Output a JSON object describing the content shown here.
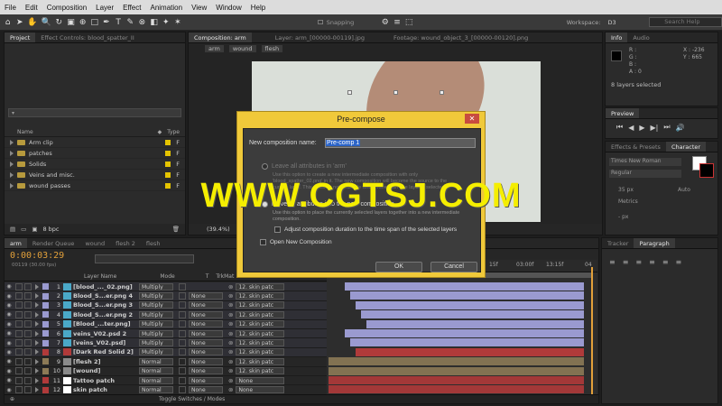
{
  "menu": [
    "File",
    "Edit",
    "Composition",
    "Layer",
    "Effect",
    "Animation",
    "View",
    "Window",
    "Help"
  ],
  "toolbar": {
    "snapping": "Snapping",
    "workspace_label": "Workspace:",
    "workspace_value": "D3",
    "search_placeholder": "Search Help"
  },
  "project_panel": {
    "tabs": [
      "Project",
      "Effect Controls: blood_spatter_II"
    ],
    "columns": {
      "name": "Name",
      "type": "Type"
    },
    "items": [
      {
        "label": "Arm clip",
        "type": "F"
      },
      {
        "label": "patches",
        "type": "F"
      },
      {
        "label": "Solids",
        "type": "F"
      },
      {
        "label": "Veins and misc.",
        "type": "F"
      },
      {
        "label": "wound passes",
        "type": "F"
      }
    ],
    "bpc": "8 bpc"
  },
  "comp_panel": {
    "tabs": [
      "Composition: arm",
      "Layer: arm_[00000-00119].jpg",
      "Footage: wound_object_3_[00000-00120].png"
    ],
    "breadcrumbs": [
      "arm",
      "wound",
      "flesh"
    ],
    "zoom": "(39.4%)"
  },
  "info_panel": {
    "tabs": [
      "Info",
      "Audio"
    ],
    "x": "X : -236",
    "y": "Y : 665",
    "a": "A : 0",
    "status": "8 layers selected"
  },
  "right_panels": {
    "preview": "Preview",
    "effects_tab": "Effects & Presets",
    "character_tab": "Character",
    "font": "Times New Roman",
    "style": "Regular",
    "size": "35 px",
    "leading": "Auto",
    "kerning": "Metrics",
    "px": "- px",
    "tracker_tab": "Tracker",
    "paragraph_tab": "Paragraph",
    "fill_color": "#ffffff",
    "stroke_color": "#000000"
  },
  "timeline": {
    "tabs": [
      "arm",
      "Render Queue",
      "wound",
      "flesh 2",
      "flesh"
    ],
    "timecode": "0:00:03:29",
    "fps": "00119 (30.00 fps)",
    "columns": {
      "layer_name": "Layer Name",
      "mode": "Mode",
      "t": "T",
      "trkmat": "TrkMat",
      "parent": "Parent"
    },
    "ruler": [
      "15f",
      "03:00f",
      "13:15f",
      "04"
    ],
    "toggle_label": "Toggle Switches / Modes",
    "layers": [
      {
        "num": "1",
        "name": "[blood_..._02.png]",
        "mode": "Multiply",
        "trkmat": "",
        "parent": "12. skin patc",
        "color": "#9a9ad0",
        "icon": "image"
      },
      {
        "num": "2",
        "name": "Blood_S...er.png 4",
        "mode": "Multiply",
        "trkmat": "None",
        "parent": "12. skin patc",
        "color": "#9a9ad0",
        "icon": "image"
      },
      {
        "num": "3",
        "name": "Blood_S...er.png 3",
        "mode": "Multiply",
        "trkmat": "None",
        "parent": "12. skin patc",
        "color": "#9a9ad0",
        "icon": "image"
      },
      {
        "num": "4",
        "name": "Blood_S...er.png 2",
        "mode": "Multiply",
        "trkmat": "None",
        "parent": "12. skin patc",
        "color": "#9a9ad0",
        "icon": "image"
      },
      {
        "num": "5",
        "name": "[Blood_...ter.png]",
        "mode": "Multiply",
        "trkmat": "None",
        "parent": "12. skin patc",
        "color": "#9a9ad0",
        "icon": "image"
      },
      {
        "num": "6",
        "name": "veins_V02.psd 2",
        "mode": "Multiply",
        "trkmat": "None",
        "parent": "12. skin patc",
        "color": "#9a9ad0",
        "icon": "image"
      },
      {
        "num": "7",
        "name": "[veins_V02.psd]",
        "mode": "Multiply",
        "trkmat": "None",
        "parent": "12. skin patc",
        "color": "#9a9ad0",
        "icon": "image"
      },
      {
        "num": "8",
        "name": "[Dark Red Solid 2]",
        "mode": "Multiply",
        "trkmat": "None",
        "parent": "12. skin patc",
        "color": "#b03a3a",
        "icon": "solid"
      },
      {
        "num": "9",
        "name": "[flesh 2]",
        "mode": "Normal",
        "trkmat": "None",
        "parent": "12. skin patc",
        "color": "#8c7a56",
        "icon": "comp"
      },
      {
        "num": "10",
        "name": "[wound]",
        "mode": "Normal",
        "trkmat": "None",
        "parent": "12. skin patc",
        "color": "#8c7a56",
        "icon": "comp"
      },
      {
        "num": "11",
        "name": "Tattoo patch",
        "mode": "Normal",
        "trkmat": "None",
        "parent": "None",
        "color": "#b03a3a",
        "icon": "shape"
      },
      {
        "num": "12",
        "name": "skin patch",
        "mode": "Normal",
        "trkmat": "None",
        "parent": "None",
        "color": "#b03a3a",
        "icon": "shape"
      }
    ]
  },
  "dialog": {
    "title": "Pre-compose",
    "name_label": "New composition name:",
    "name_value": "Pre-comp 1",
    "option1": "Leave all attributes in 'arm'",
    "option1_desc": "Use this option to create a new intermediate composition with only 'blood_spatter_02.png' in it. The new composition will become the source to the current layer. This option is not available when more than one layer is selected.",
    "option2": "Move all attributes into the new composition",
    "option2_desc": "Use this option to place the currently selected layers together into a new intermediate composition.",
    "adjust_label": "Adjust composition duration to the time span of the selected layers",
    "open_label": "Open New Composition",
    "ok": "OK",
    "cancel": "Cancel"
  },
  "watermark": "WWW.CGTSJ.COM"
}
